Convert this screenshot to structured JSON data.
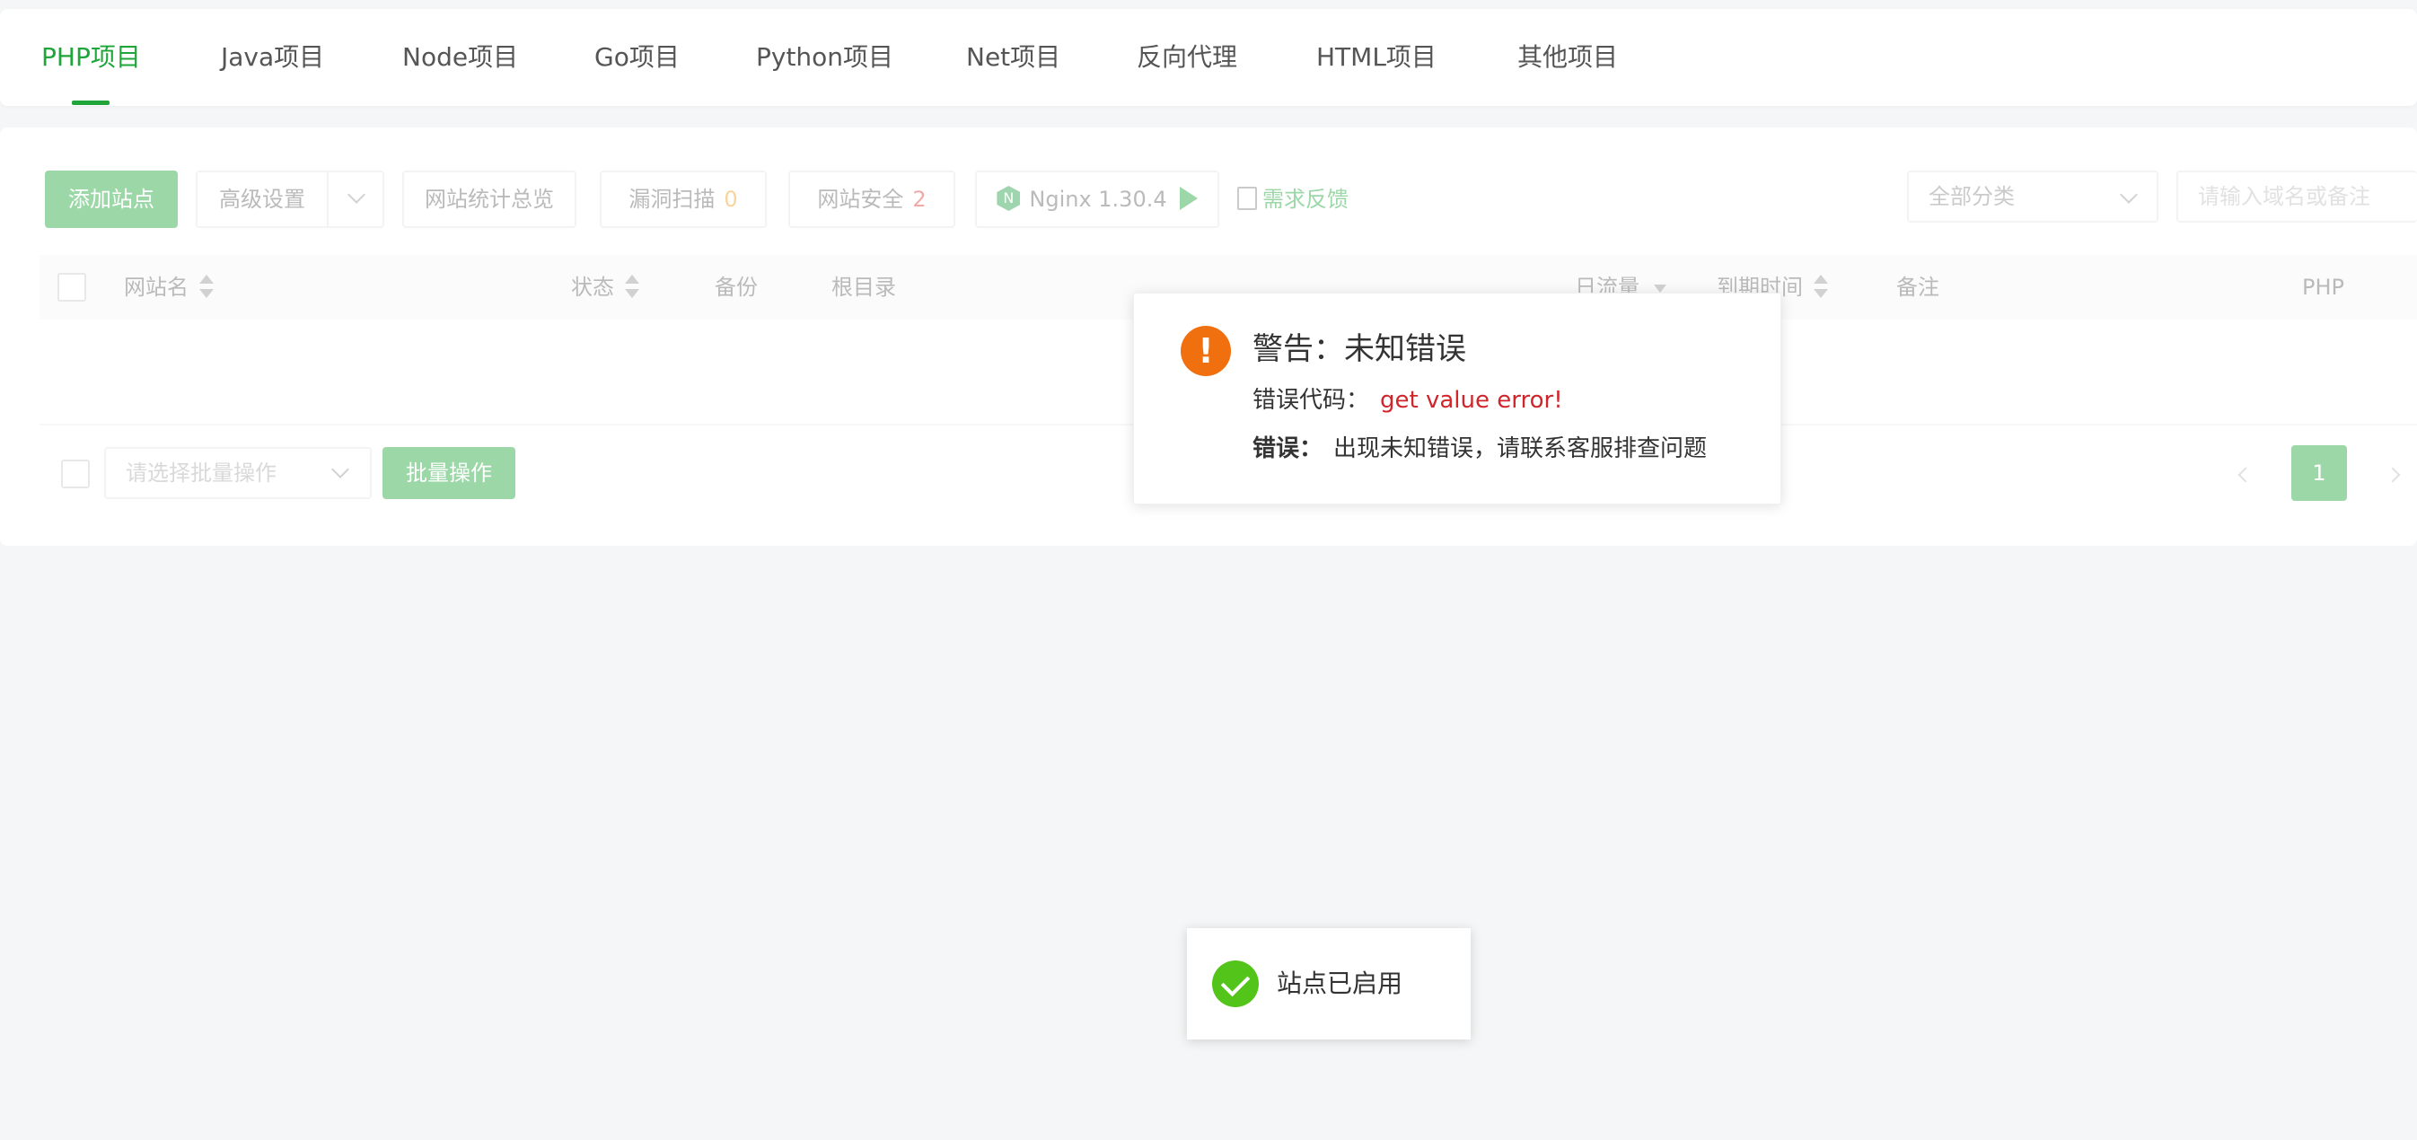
{
  "tabs": [
    {
      "label": "PHP项目",
      "active": true
    },
    {
      "label": "Java项目"
    },
    {
      "label": "Node项目"
    },
    {
      "label": "Go项目"
    },
    {
      "label": "Python项目"
    },
    {
      "label": "Net项目"
    },
    {
      "label": "反向代理"
    },
    {
      "label": "HTML项目"
    },
    {
      "label": "其他项目"
    }
  ],
  "toolbar": {
    "add_site": "添加站点",
    "advanced": "高级设置",
    "stats": "网站统计总览",
    "vuln_scan": "漏洞扫描",
    "vuln_count": "0",
    "site_security": "网站安全",
    "security_count": "2",
    "nginx": "Nginx 1.30.4",
    "feedback": "需求反馈",
    "category": "全部分类",
    "search_placeholder": "请输入域名或备注"
  },
  "table": {
    "columns": {
      "name": "网站名",
      "status": "状态",
      "backup": "备份",
      "root": "根目录",
      "traffic": "日流量",
      "expire": "到期时间",
      "remark": "备注",
      "php": "PHP"
    },
    "rows": []
  },
  "footer": {
    "batch_placeholder": "请选择批量操作",
    "batch_button": "批量操作",
    "current_page": "1"
  },
  "dialog": {
    "title": "警告：未知错误",
    "code_label": "错误代码：",
    "code_value": "get value error!",
    "error_label": "错误：",
    "error_message": "出现未知错误，请联系客服排查问题"
  },
  "toast": {
    "message": "站点已启用"
  },
  "colors": {
    "accent": "#20a53a",
    "warning": "#f0700f",
    "error_text": "#d0262b",
    "success": "#52c41a"
  }
}
